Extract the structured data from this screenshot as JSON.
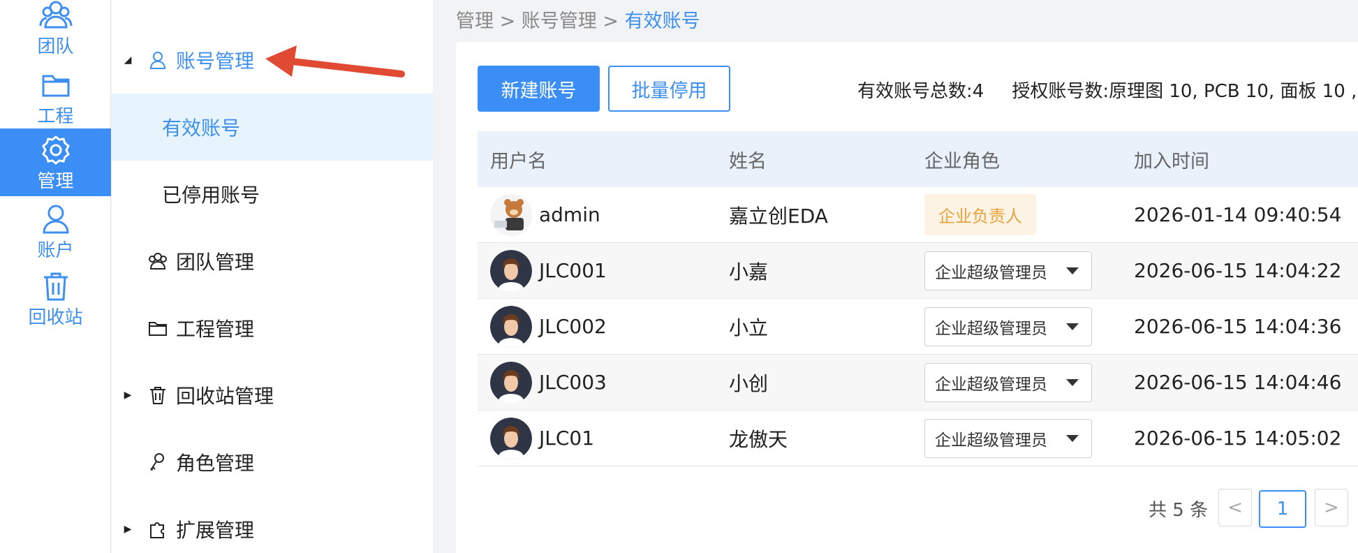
{
  "rail": {
    "items": [
      {
        "label": "团队",
        "icon": "team-icon"
      },
      {
        "label": "工程",
        "icon": "folder-icon"
      },
      {
        "label": "管理",
        "icon": "gear-icon",
        "active": true
      },
      {
        "label": "账户",
        "icon": "user-icon"
      },
      {
        "label": "回收站",
        "icon": "trash-icon"
      }
    ],
    "accent": "#3a8ef5"
  },
  "menu": {
    "account_mgmt": "账号管理",
    "active_accounts": "有效账号",
    "disabled_accounts": "已停用账号",
    "team_mgmt": "团队管理",
    "project_mgmt": "工程管理",
    "recycle_mgmt": "回收站管理",
    "role_mgmt": "角色管理",
    "extension_mgmt": "扩展管理"
  },
  "breadcrumb": {
    "root": "管理",
    "sep1": " > ",
    "mid": "账号管理",
    "sep2": " > ",
    "current": "有效账号"
  },
  "toolbar": {
    "new_account": "新建账号",
    "batch_disable": "批量停用",
    "total_label": "有效账号总数:4",
    "license_label": "授权账号数:原理图 10, PCB 10, 面板 10 ,"
  },
  "table": {
    "headers": [
      "用户名",
      "姓名",
      "企业角色",
      "加入时间"
    ],
    "rows": [
      {
        "username": "admin",
        "name": "嘉立创EDA",
        "role": "企业负责人",
        "role_type": "tag",
        "joined": "2026-01-14 09:40:54"
      },
      {
        "username": "JLC001",
        "name": "小嘉",
        "role": "企业超级管理员",
        "role_type": "select",
        "joined": "2026-06-15 14:04:22"
      },
      {
        "username": "JLC002",
        "name": "小立",
        "role": "企业超级管理员",
        "role_type": "select",
        "joined": "2026-06-15 14:04:36"
      },
      {
        "username": "JLC003",
        "name": "小创",
        "role": "企业超级管理员",
        "role_type": "select",
        "joined": "2026-06-15 14:04:46"
      },
      {
        "username": "JLC01",
        "name": "龙傲天",
        "role": "企业超级管理员",
        "role_type": "select",
        "joined": "2026-06-15 14:05:02"
      }
    ]
  },
  "pager": {
    "total": "共 5 条",
    "prev": "<",
    "current": "1",
    "next": ">"
  }
}
